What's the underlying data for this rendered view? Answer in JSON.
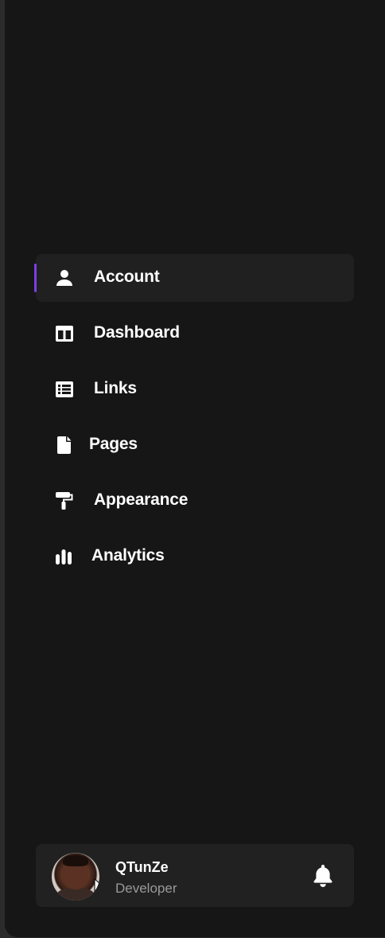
{
  "nav": {
    "items": [
      {
        "label": "Account",
        "icon": "user-icon",
        "active": true
      },
      {
        "label": "Dashboard",
        "icon": "layout-columns-icon",
        "active": false
      },
      {
        "label": "Links",
        "icon": "list-table-icon",
        "active": false
      },
      {
        "label": "Pages",
        "icon": "file-icon",
        "active": false
      },
      {
        "label": "Appearance",
        "icon": "paint-roller-icon",
        "active": false
      },
      {
        "label": "Analytics",
        "icon": "bar-chart-icon",
        "active": false
      }
    ]
  },
  "user": {
    "name": "QTunZe",
    "role": "Developer",
    "avatar_icon": "avatar",
    "notification_icon": "bell-icon"
  },
  "colors": {
    "background": "#161616",
    "active_item_bg": "#202020",
    "accent": "#7b3fe4",
    "text": "#ffffff",
    "muted_text": "#9a9a9a"
  }
}
